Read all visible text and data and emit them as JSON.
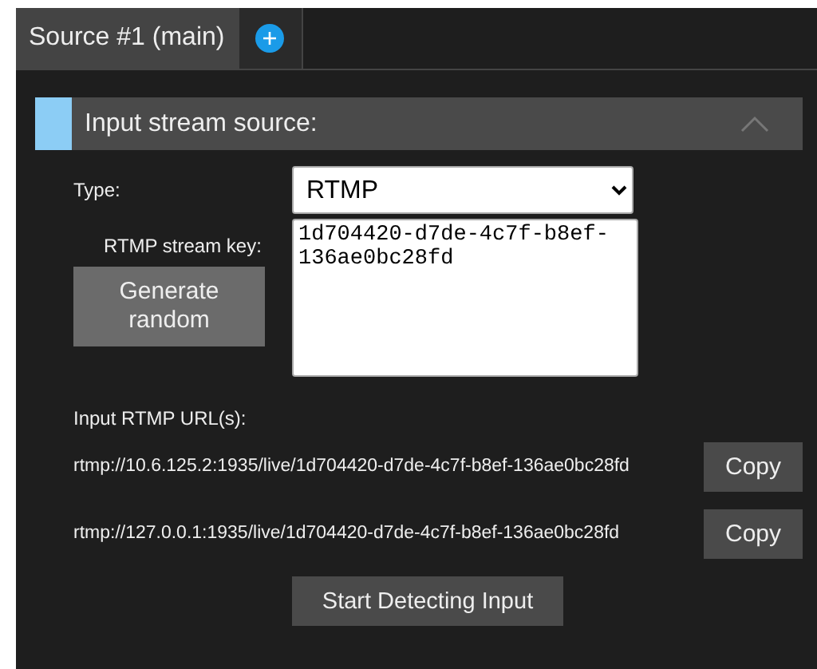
{
  "tabs": [
    {
      "label": "Source #1 (main)",
      "selected": true
    },
    {
      "kind": "add",
      "selected": false
    }
  ],
  "section": {
    "title": "Input stream source:",
    "expanded": true
  },
  "type_field": {
    "label": "Type:",
    "value": "RTMP"
  },
  "stream_key": {
    "label": "RTMP stream key:",
    "value": "1d704420-d7de-4c7f-b8ef-136ae0bc28fd",
    "button": "Generate random"
  },
  "urls_label": "Input RTMP URL(s):",
  "urls": [
    {
      "url": "rtmp://10.6.125.2:1935/live/1d704420-d7de-4c7f-b8ef-136ae0bc28fd",
      "button": "Copy"
    },
    {
      "url": "rtmp://127.0.0.1:1935/live/1d704420-d7de-4c7f-b8ef-136ae0bc28fd",
      "button": "Copy"
    }
  ],
  "detect_button": "Start Detecting Input"
}
